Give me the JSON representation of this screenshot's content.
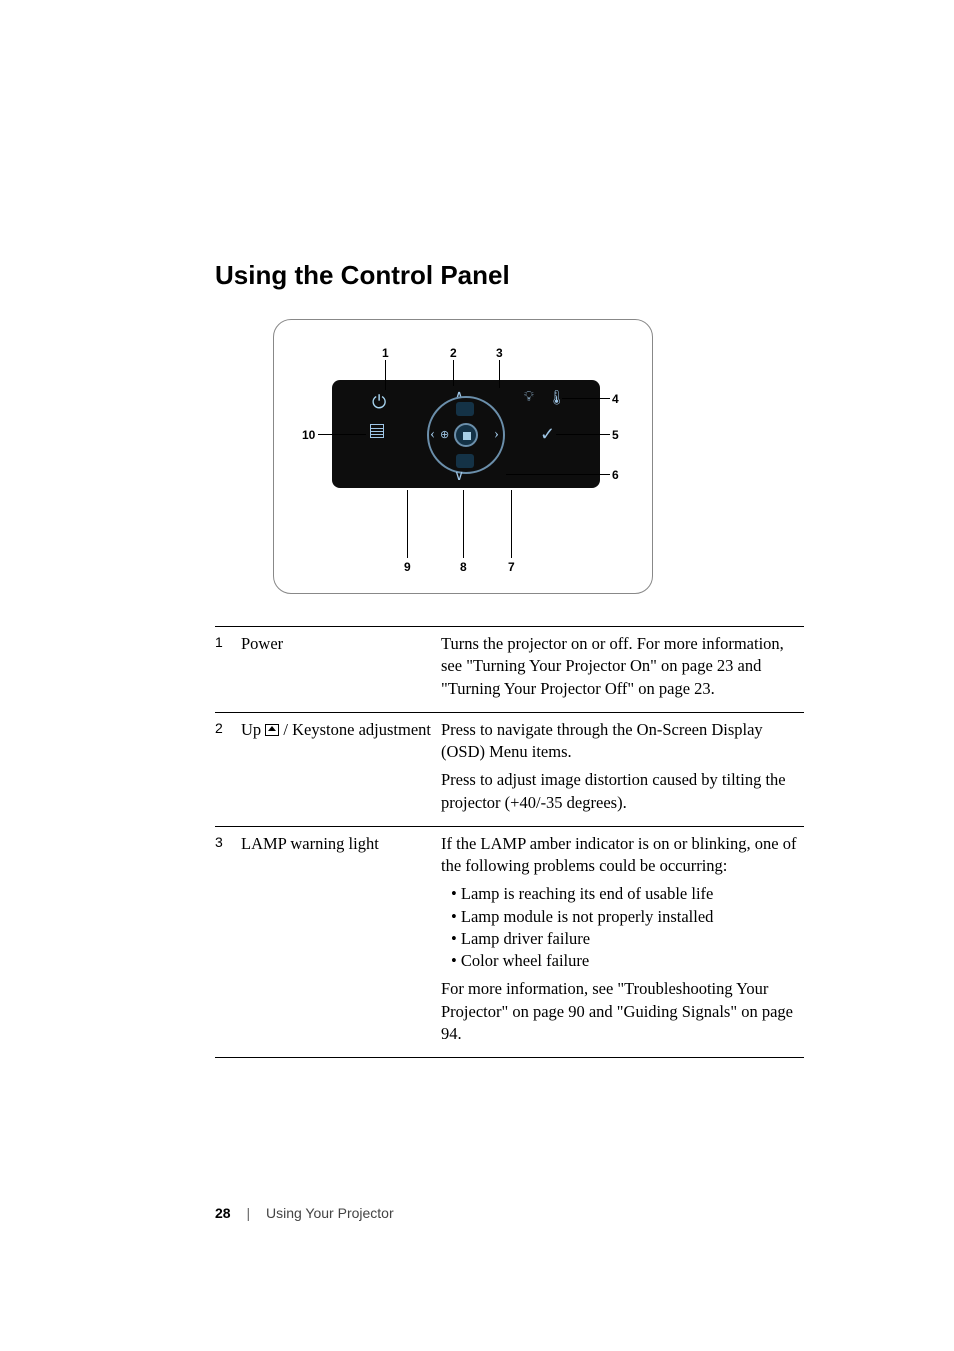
{
  "heading": "Using the Control Panel",
  "figure": {
    "callouts": {
      "c1": "1",
      "c2": "2",
      "c3": "3",
      "c4": "4",
      "c5": "5",
      "c6": "6",
      "c7": "7",
      "c8": "8",
      "c9": "9",
      "c10": "10"
    }
  },
  "table": {
    "row1": {
      "num": "1",
      "label": "Power",
      "text": "Turns the projector on or off. For more information, see \"Turning Your Projector On\" on page 23 and \"Turning Your Projector Off\" on page 23."
    },
    "row2": {
      "num": "2",
      "label_pre": "Up ",
      "label_post": " / Keystone adjustment",
      "p1": "Press to navigate through the On-Screen Display (OSD) Menu items.",
      "p2": "Press to adjust image distortion caused by tilting the projector (+40/-35 degrees)."
    },
    "row3": {
      "num": "3",
      "label": "LAMP warning light",
      "p1": "If the LAMP amber indicator is on or blinking, one of the following problems could be occurring:",
      "b1": "Lamp is reaching its end of usable life",
      "b2": "Lamp module is not properly installed",
      "b3": "Lamp driver failure",
      "b4": "Color wheel failure",
      "p2": "For more information, see \"Troubleshooting Your Projector\" on page 90 and \"Guiding Signals\" on page 94."
    }
  },
  "footer": {
    "page": "28",
    "section": "Using Your Projector"
  }
}
